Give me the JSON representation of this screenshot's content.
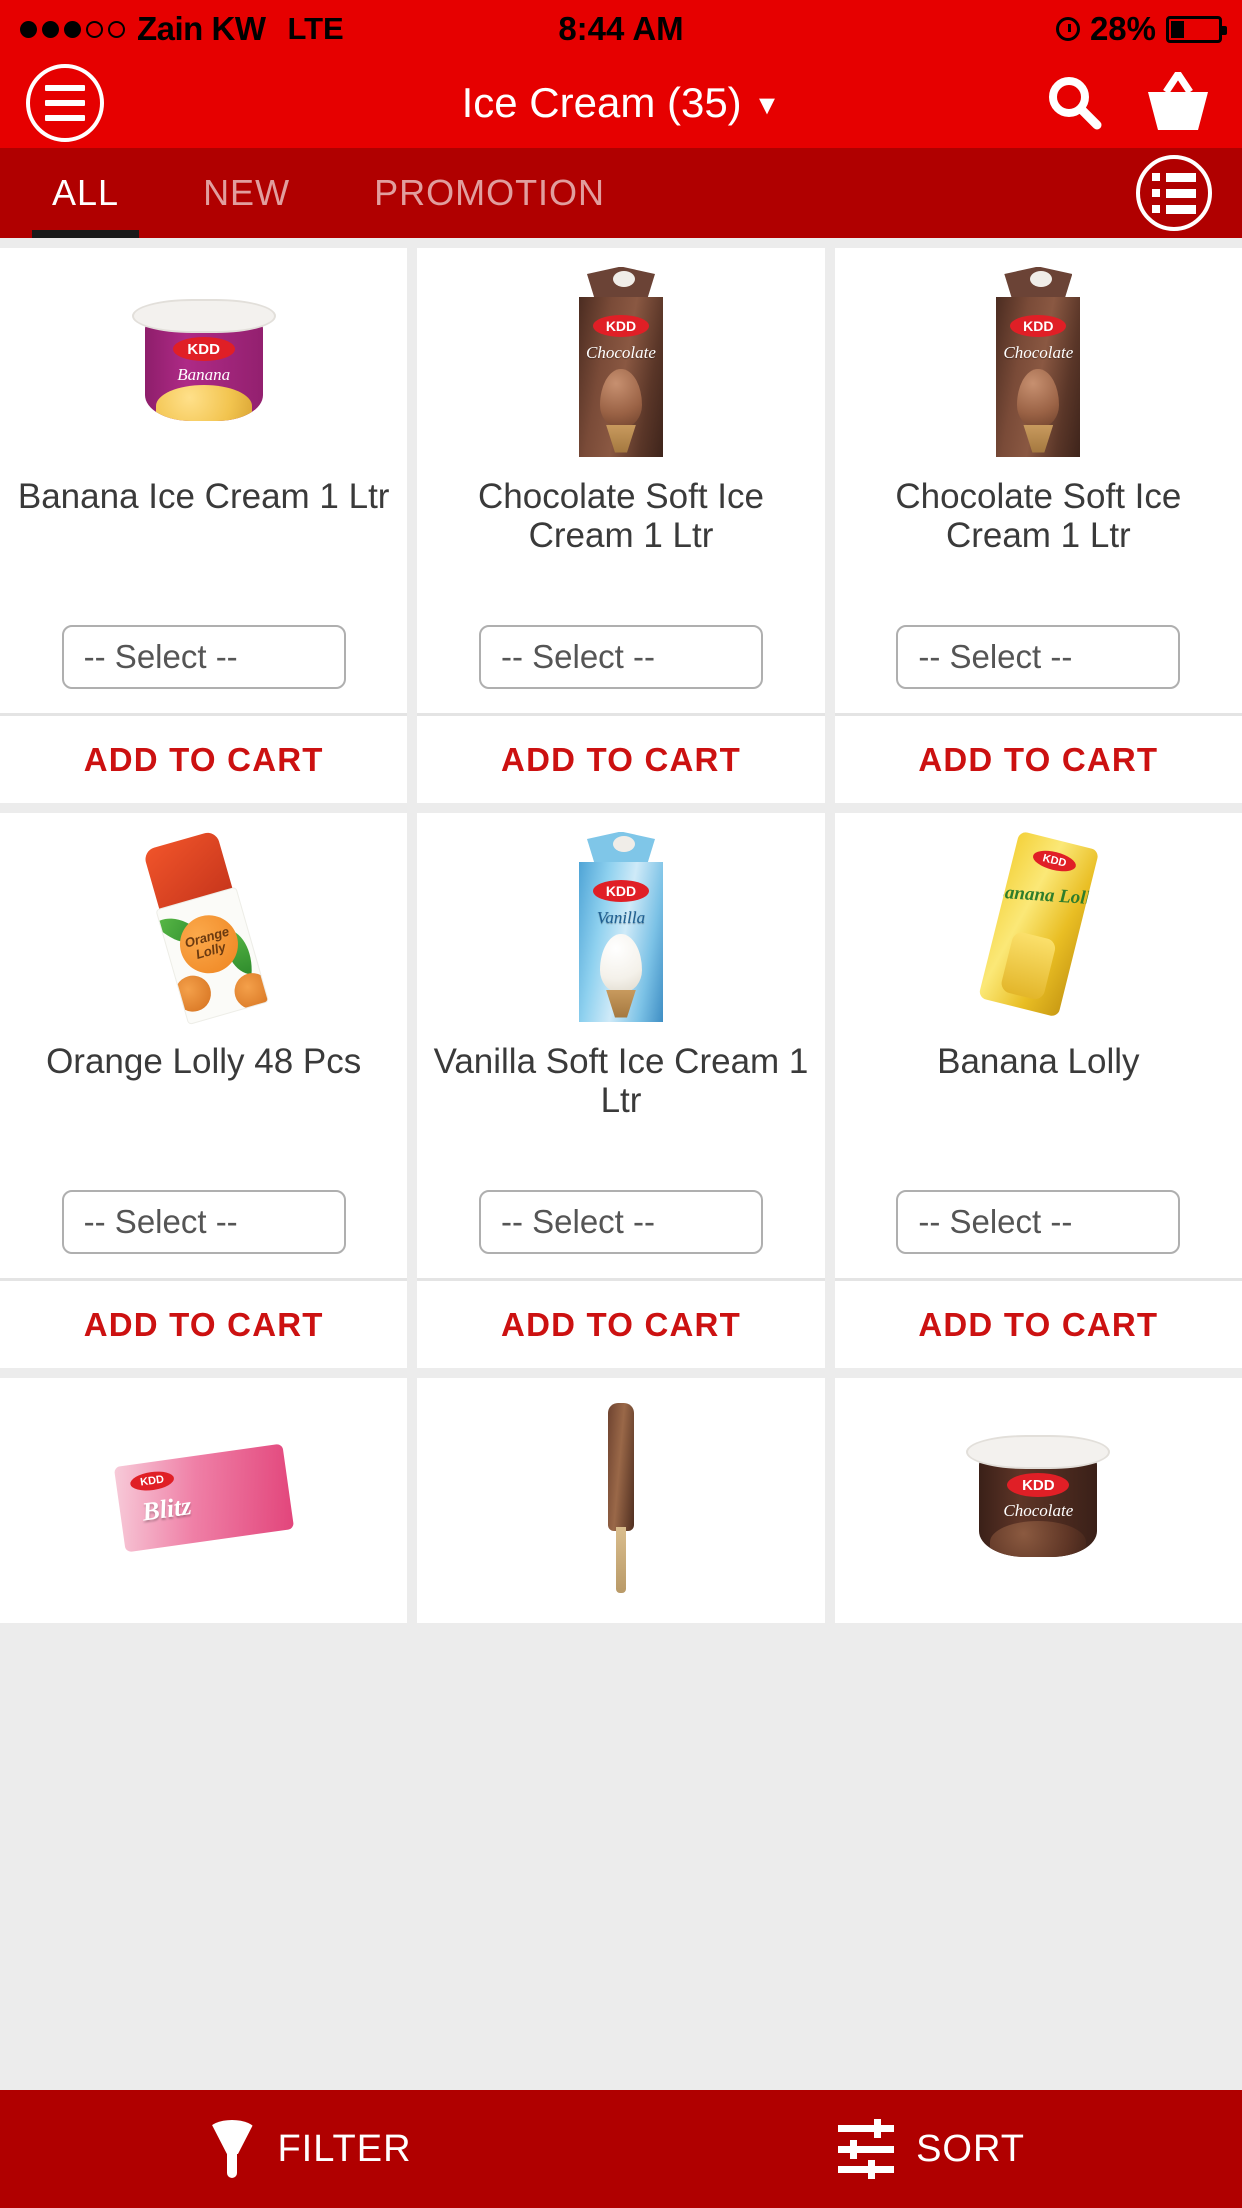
{
  "statusbar": {
    "carrier": "Zain KW",
    "network": "LTE",
    "time": "8:44 AM",
    "battery": "28%",
    "signal_dots_filled": 3,
    "signal_dots_total": 5
  },
  "header": {
    "title": "Ice Cream (35)",
    "caret": "▼",
    "menu_icon": "hamburger-icon",
    "search_icon": "search-icon",
    "cart_icon": "basket-icon",
    "background": "#E60000"
  },
  "tabs": {
    "background": "#B00000",
    "items": [
      {
        "label": "ALL",
        "active": true
      },
      {
        "label": "NEW",
        "active": false
      },
      {
        "label": "PROMOTION",
        "active": false
      }
    ],
    "view_toggle_icon": "list-view-icon"
  },
  "products": [
    {
      "name": "Banana Ice Cream 1 Ltr",
      "select": "-- Select --",
      "add": "ADD TO CART",
      "art": "tub-banana"
    },
    {
      "name": "Chocolate Soft Ice Cream 1 Ltr",
      "select": "-- Select --",
      "add": "ADD TO CART",
      "art": "carton-chocolate"
    },
    {
      "name": "Chocolate Soft Ice Cream 1 Ltr",
      "select": "-- Select --",
      "add": "ADD TO CART",
      "art": "carton-chocolate"
    },
    {
      "name": "Orange Lolly 48 Pcs",
      "select": "-- Select --",
      "add": "ADD TO CART",
      "art": "lolly-orange"
    },
    {
      "name": "Vanilla Soft Ice Cream 1 Ltr",
      "select": "-- Select --",
      "add": "ADD TO CART",
      "art": "carton-vanilla"
    },
    {
      "name": "Banana Lolly",
      "select": "-- Select --",
      "add": "ADD TO CART",
      "art": "lolly-banana"
    }
  ],
  "products_partial": [
    {
      "art": "bar-blitz"
    },
    {
      "art": "stick-choco"
    },
    {
      "art": "tub-chocolate"
    }
  ],
  "labels": {
    "kdd": "KDD",
    "banana_flavour": "Banana",
    "chocolate_flavour": "Chocolate",
    "vanilla_flavour": "Vanilla",
    "orange_lolly_badge": "Orange Lolly",
    "banana_lolly_text": "Banana Lolly",
    "blitz_name": "Blitz"
  },
  "bottombar": {
    "background": "#B00000",
    "filter_label": "FILTER",
    "filter_icon": "funnel-icon",
    "sort_label": "SORT",
    "sort_icon": "sliders-icon"
  },
  "colors": {
    "header_red": "#E60000",
    "dark_red": "#B00000",
    "cta_red": "#CC1111",
    "page_bg": "#ECECEC",
    "card_bg": "#FFFFFF",
    "title_text": "#3A3A3A"
  }
}
